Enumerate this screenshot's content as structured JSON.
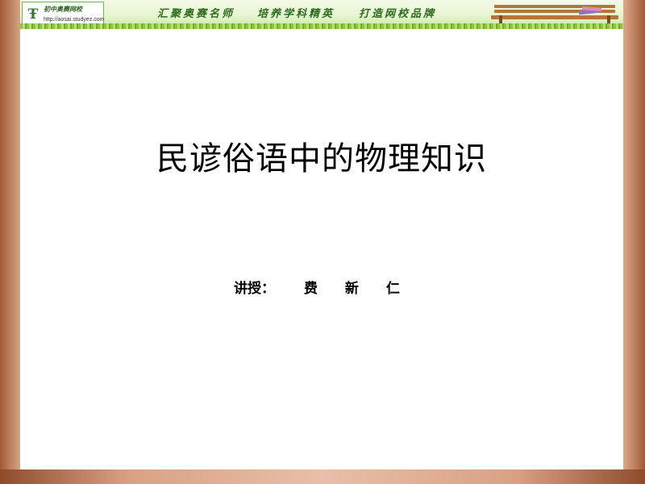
{
  "header": {
    "logo": {
      "name": "初中奥赛网校",
      "url": "http://aosai.studyez.com",
      "icon": "school-logo-icon"
    },
    "slogans": [
      "汇聚奥赛名师",
      "培养学科精英",
      "打造网校品牌"
    ],
    "decoration_icon": "park-bench-icon",
    "colors": {
      "accent": "#2b6a1f",
      "banner": "#e5f5cf"
    }
  },
  "slide": {
    "title": "民谚俗语中的物理知识",
    "lecturer_label": "讲授：",
    "lecturer_name": "费 新 仁"
  }
}
